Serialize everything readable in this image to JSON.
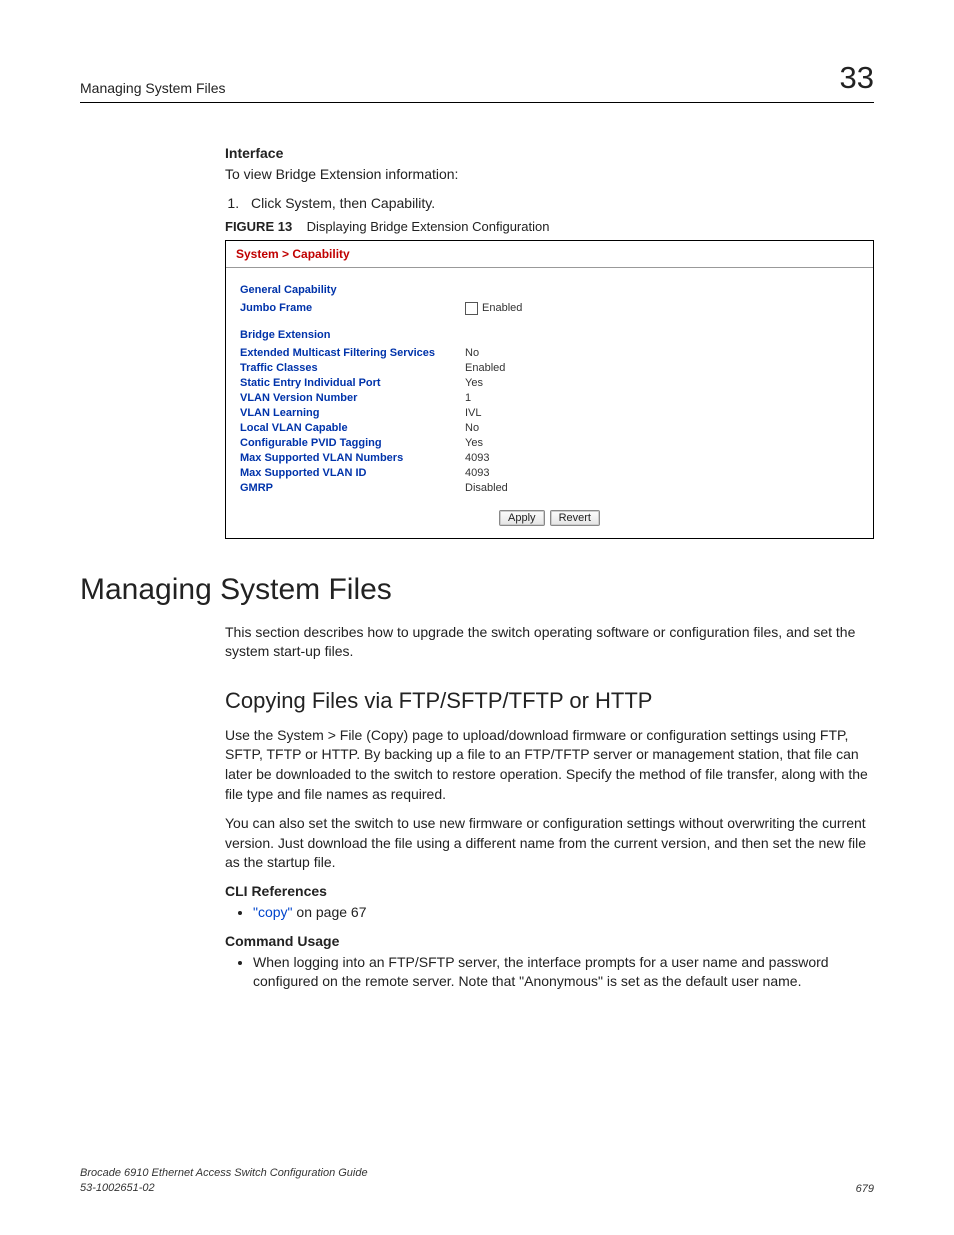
{
  "header": {
    "running": "Managing System Files",
    "chapter": "33"
  },
  "interface": {
    "heading": "Interface",
    "text": "To view Bridge Extension information:",
    "step1": "Click System, then Capability."
  },
  "figure": {
    "label": "FIGURE 13",
    "caption": "Displaying Bridge Extension Configuration"
  },
  "ui": {
    "breadcrumb": "System > Capability",
    "general_heading": "General Capability",
    "jumbo_label": "Jumbo Frame",
    "jumbo_value": "Enabled",
    "bridge_heading": "Bridge Extension",
    "rows": [
      {
        "label": "Extended Multicast Filtering Services",
        "value": "No"
      },
      {
        "label": "Traffic Classes",
        "value": "Enabled"
      },
      {
        "label": "Static Entry Individual Port",
        "value": "Yes"
      },
      {
        "label": "VLAN Version Number",
        "value": "1"
      },
      {
        "label": "VLAN Learning",
        "value": "IVL"
      },
      {
        "label": "Local VLAN Capable",
        "value": "No"
      },
      {
        "label": "Configurable PVID Tagging",
        "value": "Yes"
      },
      {
        "label": "Max Supported VLAN Numbers",
        "value": "4093"
      },
      {
        "label": "Max Supported VLAN ID",
        "value": "4093"
      },
      {
        "label": "GMRP",
        "value": "Disabled"
      }
    ],
    "apply": "Apply",
    "revert": "Revert"
  },
  "h1": "Managing System Files",
  "intro": "This section describes how to upgrade the switch operating software or configuration files, and set the system start-up files.",
  "h2": "Copying Files via FTP/SFTP/TFTP or HTTP",
  "p1": "Use the System > File (Copy) page to upload/download firmware or configuration settings using FTP, SFTP, TFTP or HTTP. By backing up a file to an FTP/TFTP server or management station, that file can later be downloaded to the switch to restore operation. Specify the method of file transfer, along with the file type and file names as required.",
  "p2": "You can also set the switch to use new firmware or configuration settings without overwriting the current version. Just download the file using a different name from the current version, and then set the new file as the startup file.",
  "cli_heading": "CLI References",
  "cli_link": "\"copy\"",
  "cli_tail": " on page 67",
  "cmd_heading": "Command Usage",
  "cmd_bullet": "When logging into an FTP/SFTP server, the interface prompts for a user name and password configured on the remote server. Note that \"Anonymous\" is set as the default user name.",
  "footer": {
    "title": "Brocade 6910 Ethernet Access Switch Configuration Guide",
    "docnum": "53-1002651-02",
    "page": "679"
  }
}
